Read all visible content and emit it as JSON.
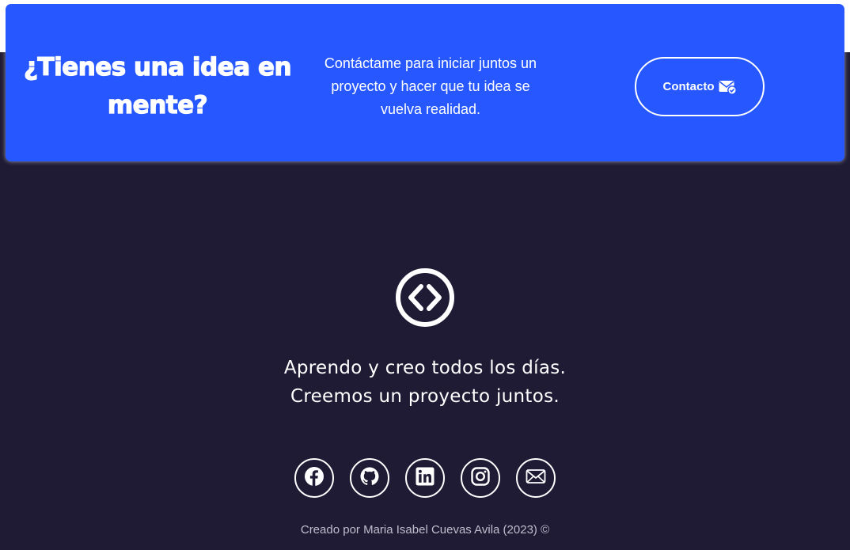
{
  "cta": {
    "title": "¿Tienes una idea en mente?",
    "text": "Contáctame para iniciar juntos un proyecto y hacer que tu idea se vuelva realidad.",
    "button_label": "Contacto",
    "button_icon": "mail-check-icon"
  },
  "footer": {
    "logo_icon": "code-brackets-icon",
    "tagline_line1": "Aprendo y creo todos los días.",
    "tagline_line2": "Creemos un proyecto juntos.",
    "socials": [
      {
        "icon": "facebook-icon"
      },
      {
        "icon": "github-icon"
      },
      {
        "icon": "linkedin-icon"
      },
      {
        "icon": "instagram-icon"
      },
      {
        "icon": "email-icon"
      }
    ],
    "credit": "Creado por Maria Isabel Cuevas Avila (2023) ©"
  },
  "colors": {
    "background": "#1f1b35",
    "accent": "#2657ff",
    "text": "#ffffff"
  }
}
